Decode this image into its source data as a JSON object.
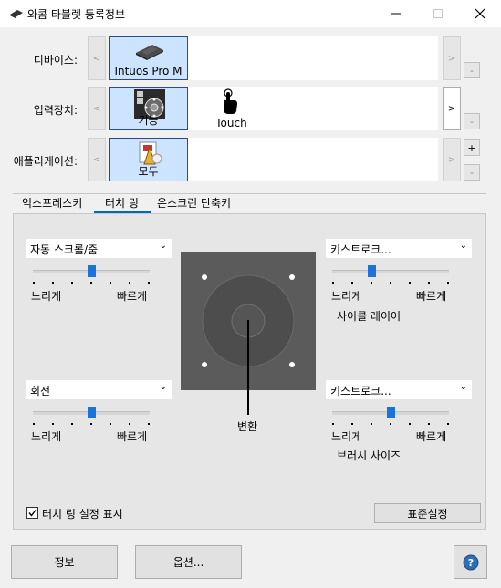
{
  "window": {
    "title": "와콤 타블렛 등록정보"
  },
  "rows": {
    "device": {
      "label": "디바이스:",
      "tile": "Intuos Pro M"
    },
    "input": {
      "label": "입력장치:",
      "tile": "기능",
      "second": "Touch"
    },
    "app": {
      "label": "애플리케이션:",
      "tile": "모두"
    }
  },
  "side_buttons": {
    "minus": "-",
    "plus": "+"
  },
  "arrows": {
    "left": "<",
    "right": ">"
  },
  "tabs": [
    "익스프레스키",
    "터치 링",
    "온스크린 단축키"
  ],
  "ring": {
    "tl": {
      "dropdown": "자동 스크롤/줌",
      "slow": "느리게",
      "fast": "빠르게",
      "level": 0.5
    },
    "bl": {
      "dropdown": "회전",
      "slow": "느리게",
      "fast": "빠르게",
      "level": 0.5
    },
    "tr": {
      "dropdown": "키스트로크...",
      "slow": "느리게",
      "fast": "빠르게",
      "level": 0.33,
      "caption": "사이클 레이어"
    },
    "br": {
      "dropdown": "키스트로크...",
      "slow": "느리게",
      "fast": "빠르게",
      "level": 0.5,
      "caption": "브러시 사이즈"
    },
    "center_label": "변환"
  },
  "show_settings": {
    "label": "터치 링 설정 표시",
    "checked": true
  },
  "default_button": "표준설정",
  "footer": {
    "about": "정보",
    "options": "옵션...",
    "help": "?"
  }
}
